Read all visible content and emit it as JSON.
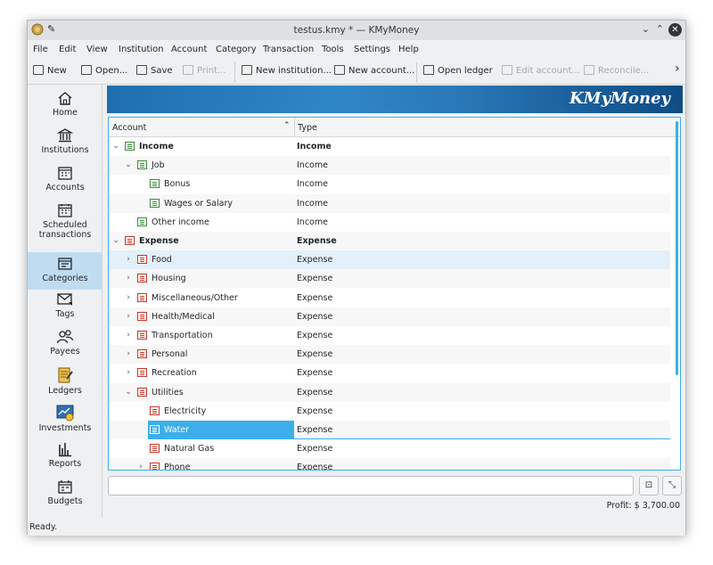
{
  "window": {
    "title": "testus.kmy * — KMyMoney"
  },
  "menubar": [
    "File",
    "Edit",
    "View",
    "Institution",
    "Account",
    "Category",
    "Transaction",
    "Tools",
    "Settings",
    "Help"
  ],
  "toolbar": {
    "new": "New",
    "open": "Open...",
    "save": "Save",
    "print": "Print...",
    "new_institution": "New institution...",
    "new_account": "New account...",
    "open_ledger": "Open ledger",
    "edit_account": "Edit account...",
    "reconcile": "Reconcile...",
    "overflow": "›"
  },
  "sidebar": [
    {
      "label": "Home",
      "icon": "home-icon"
    },
    {
      "label": "Institutions",
      "icon": "institution-icon"
    },
    {
      "label": "Accounts",
      "icon": "accounts-icon"
    },
    {
      "label": "Scheduled transactions",
      "icon": "calendar-icon"
    },
    {
      "label": "Categories",
      "icon": "categories-icon",
      "active": true
    },
    {
      "label": "Tags",
      "icon": "tag-icon"
    },
    {
      "label": "Payees",
      "icon": "payees-icon"
    },
    {
      "label": "Ledgers",
      "icon": "ledger-icon"
    },
    {
      "label": "Investments",
      "icon": "investments-icon"
    },
    {
      "label": "Reports",
      "icon": "reports-icon"
    },
    {
      "label": "Budgets",
      "icon": "budget-icon"
    }
  ],
  "banner": {
    "brand": "KMyMoney"
  },
  "tree": {
    "columns": [
      "Account",
      "Type"
    ],
    "rows": [
      {
        "name": "Income",
        "type": "Income",
        "level": 0,
        "expander": "open",
        "kind": "inc",
        "bold": true
      },
      {
        "name": "Job",
        "type": "Income",
        "level": 1,
        "expander": "open",
        "kind": "inc"
      },
      {
        "name": "Bonus",
        "type": "Income",
        "level": 2,
        "expander": "",
        "kind": "inc"
      },
      {
        "name": "Wages or Salary",
        "type": "Income",
        "level": 2,
        "expander": "",
        "kind": "inc"
      },
      {
        "name": "Other income",
        "type": "Income",
        "level": 1,
        "expander": "",
        "kind": "inc"
      },
      {
        "name": "Expense",
        "type": "Expense",
        "level": 0,
        "expander": "open",
        "kind": "exp",
        "bold": true
      },
      {
        "name": "Food",
        "type": "Expense",
        "level": 1,
        "expander": "closed",
        "kind": "exp",
        "hover": true
      },
      {
        "name": "Housing",
        "type": "Expense",
        "level": 1,
        "expander": "closed",
        "kind": "exp"
      },
      {
        "name": "Miscellaneous/Other",
        "type": "Expense",
        "level": 1,
        "expander": "closed",
        "kind": "exp"
      },
      {
        "name": "Health/Medical",
        "type": "Expense",
        "level": 1,
        "expander": "closed",
        "kind": "exp"
      },
      {
        "name": "Transportation",
        "type": "Expense",
        "level": 1,
        "expander": "closed",
        "kind": "exp"
      },
      {
        "name": "Personal",
        "type": "Expense",
        "level": 1,
        "expander": "closed",
        "kind": "exp"
      },
      {
        "name": "Recreation",
        "type": "Expense",
        "level": 1,
        "expander": "closed",
        "kind": "exp"
      },
      {
        "name": "Utilities",
        "type": "Expense",
        "level": 1,
        "expander": "open",
        "kind": "exp"
      },
      {
        "name": "Electricity",
        "type": "Expense",
        "level": 2,
        "expander": "",
        "kind": "exp"
      },
      {
        "name": "Water",
        "type": "Expense",
        "level": 2,
        "expander": "",
        "kind": "exp",
        "selected": true
      },
      {
        "name": "Natural Gas",
        "type": "Expense",
        "level": 2,
        "expander": "",
        "kind": "exp"
      },
      {
        "name": "Phone",
        "type": "Expense",
        "level": 2,
        "expander": "closed",
        "kind": "exp"
      }
    ]
  },
  "search": {
    "placeholder": ""
  },
  "footer": {
    "profit": "Profit: $ 3,700.00"
  },
  "status": {
    "text": "Ready."
  },
  "colors": {
    "accent": "#3daee9",
    "selection_hover": "#e3eff9",
    "income_icon": "#3c8a3c",
    "expense_icon": "#c0392b"
  }
}
